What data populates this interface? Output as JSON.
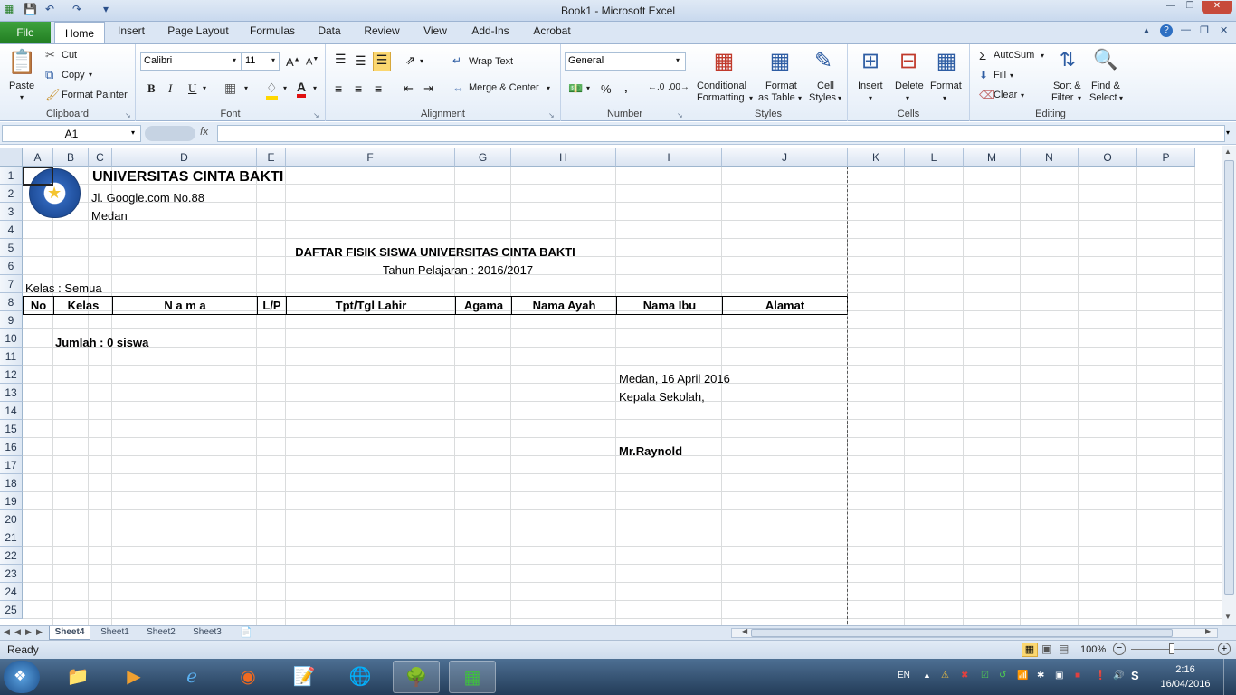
{
  "window": {
    "title": "Book1  -  Microsoft Excel"
  },
  "tabs": {
    "file": "File",
    "home": "Home",
    "insert": "Insert",
    "page_layout": "Page Layout",
    "formulas": "Formulas",
    "data": "Data",
    "review": "Review",
    "view": "View",
    "addins": "Add-Ins",
    "acrobat": "Acrobat"
  },
  "ribbon": {
    "clipboard": {
      "label": "Clipboard",
      "paste": "Paste",
      "cut": "Cut",
      "copy": "Copy",
      "format_painter": "Format Painter"
    },
    "font": {
      "label": "Font",
      "name": "Calibri",
      "size": "11",
      "bold": "B",
      "italic": "I",
      "underline": "U"
    },
    "alignment": {
      "label": "Alignment",
      "wrap": "Wrap Text",
      "merge": "Merge & Center"
    },
    "number": {
      "label": "Number",
      "format": "General",
      "percent": "%",
      "comma": ","
    },
    "styles": {
      "label": "Styles",
      "conditional": "Conditional",
      "conditional2": "Formatting",
      "format_table": "Format",
      "format_table2": "as Table",
      "cell_styles": "Cell",
      "cell_styles2": "Styles"
    },
    "cells": {
      "label": "Cells",
      "insert": "Insert",
      "delete": "Delete",
      "format": "Format"
    },
    "editing": {
      "label": "Editing",
      "autosum": "AutoSum",
      "fill": "Fill",
      "clear": "Clear",
      "sort": "Sort &",
      "sort2": "Filter",
      "find": "Find &",
      "find2": "Select"
    }
  },
  "formula_bar": {
    "name_box": "A1",
    "fx": "fx",
    "value": ""
  },
  "columns": [
    "A",
    "B",
    "C",
    "D",
    "E",
    "F",
    "G",
    "H",
    "I",
    "J",
    "K",
    "L",
    "M",
    "N",
    "O",
    "P"
  ],
  "rows": [
    "1",
    "2",
    "3",
    "4",
    "5",
    "6",
    "7",
    "8",
    "9",
    "10",
    "11",
    "12",
    "13",
    "14",
    "15",
    "16",
    "17",
    "18",
    "19",
    "20",
    "21",
    "22",
    "23",
    "24",
    "25"
  ],
  "cells": {
    "univ": "UNIVERSITAS CINTA BAKTI",
    "address": "Jl. Google.com No.88",
    "city": "Medan",
    "report_title": "DAFTAR FISIK SISWA UNIVERSITAS CINTA BAKTI",
    "year": "Tahun Pelajaran : 2016/2017",
    "kelas": "Kelas : Semua",
    "headers": [
      "No",
      "Kelas",
      "N a m a",
      "L/P",
      "Tpt/Tgl Lahir",
      "Agama",
      "Nama Ayah",
      "Nama Ibu",
      "Alamat"
    ],
    "jumlah": "Jumlah : 0 siswa",
    "date_place": "Medan, 16 April 2016",
    "kepala": "Kepala Sekolah,",
    "signer": "Mr.Raynold"
  },
  "sheets": [
    "Sheet4",
    "Sheet1",
    "Sheet2",
    "Sheet3"
  ],
  "status": {
    "ready": "Ready",
    "zoom": "100%"
  },
  "taskbar": {
    "lang": "EN",
    "time": "2:16",
    "date": "16/04/2016"
  }
}
